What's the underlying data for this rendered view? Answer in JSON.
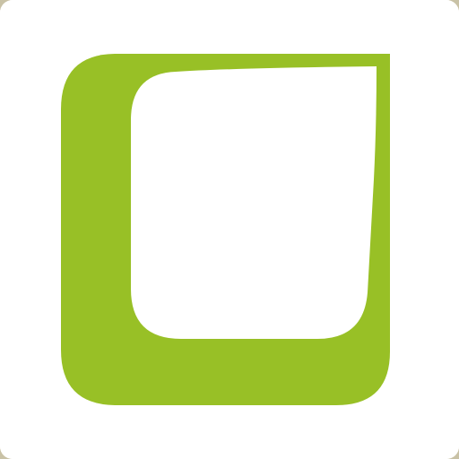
{
  "app_icon": {
    "icon_name": "green-rounded-leaf-square-logo-icon",
    "colors": {
      "background": "#ffffff",
      "corner_backdrop": "#c9c2a6",
      "brand_green": "#98c026",
      "inner_fill": "#ffffff"
    }
  }
}
